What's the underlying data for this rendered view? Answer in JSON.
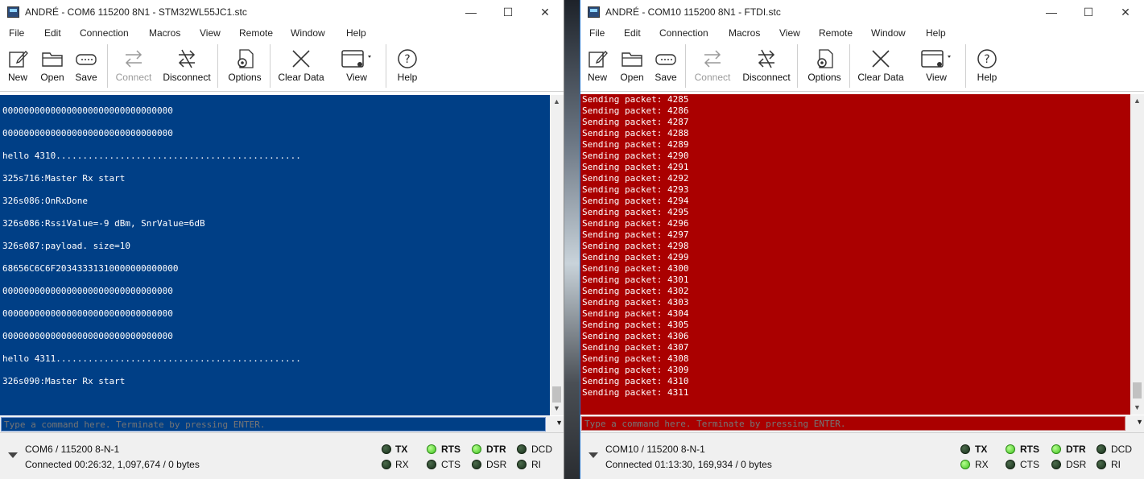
{
  "left": {
    "title": "ANDRÉ - COM6 115200 8N1 - STM32WL55JC1.stc",
    "menu": [
      "File",
      "Edit",
      "Connection",
      "Macros",
      "View",
      "Remote",
      "Window",
      "Help"
    ],
    "toolbar": {
      "new": "New",
      "open": "Open",
      "save": "Save",
      "connect": "Connect",
      "disconnect": "Disconnect",
      "options": "Options",
      "clear": "Clear Data",
      "view": "View",
      "help": "Help"
    },
    "terminal_bg": "#003f86",
    "lines": [
      "00000000000000000000000000000000",
      "",
      "00000000000000000000000000000000",
      "",
      "hello 4310..............................................",
      "",
      "325s716:Master Rx start",
      "",
      "326s086:OnRxDone",
      "",
      "326s086:RssiValue=-9 dBm, SnrValue=6dB",
      "",
      "326s087:payload. size=10",
      "",
      "68656C6C6F20343331310000000000000",
      "",
      "00000000000000000000000000000000",
      "",
      "00000000000000000000000000000000",
      "",
      "00000000000000000000000000000000",
      "",
      "hello 4311..............................................",
      "",
      "326s090:Master Rx start"
    ],
    "command_placeholder": "Type a command here. Terminate by pressing ENTER.",
    "status": {
      "port": "COM6 / 115200 8-N-1",
      "connection": "Connected 00:26:32, 1,097,674 / 0 bytes",
      "tx": "TX",
      "rx": "RX",
      "rts": "RTS",
      "cts": "CTS",
      "dtr": "DTR",
      "dsr": "DSR",
      "dcd": "DCD",
      "ri": "RI"
    }
  },
  "right": {
    "title": "ANDRÉ - COM10 115200 8N1 - FTDI.stc",
    "menu": [
      "File",
      "Edit",
      "Connection",
      "Macros",
      "View",
      "Remote",
      "Window",
      "Help"
    ],
    "toolbar": {
      "new": "New",
      "open": "Open",
      "save": "Save",
      "connect": "Connect",
      "disconnect": "Disconnect",
      "options": "Options",
      "clear": "Clear Data",
      "view": "View",
      "help": "Help"
    },
    "terminal_bg": "#aa0000",
    "lines": [
      "Sending packet: 4285",
      "Sending packet: 4286",
      "Sending packet: 4287",
      "Sending packet: 4288",
      "Sending packet: 4289",
      "Sending packet: 4290",
      "Sending packet: 4291",
      "Sending packet: 4292",
      "Sending packet: 4293",
      "Sending packet: 4294",
      "Sending packet: 4295",
      "Sending packet: 4296",
      "Sending packet: 4297",
      "Sending packet: 4298",
      "Sending packet: 4299",
      "Sending packet: 4300",
      "Sending packet: 4301",
      "Sending packet: 4302",
      "Sending packet: 4303",
      "Sending packet: 4304",
      "Sending packet: 4305",
      "Sending packet: 4306",
      "Sending packet: 4307",
      "Sending packet: 4308",
      "Sending packet: 4309",
      "Sending packet: 4310",
      "Sending packet: 4311"
    ],
    "command_placeholder": "Type a command here. Terminate by pressing ENTER.",
    "status": {
      "port": "COM10 / 115200 8-N-1",
      "connection": "Connected 01:13:30, 169,934 / 0 bytes",
      "tx": "TX",
      "rx": "RX",
      "rts": "RTS",
      "cts": "CTS",
      "dtr": "DTR",
      "dsr": "DSR",
      "dcd": "DCD",
      "ri": "RI"
    }
  },
  "title_controls": {
    "minimize": "—",
    "maximize": "☐",
    "close": "✕"
  },
  "led_states": {
    "left": {
      "tx": "off",
      "rx": "off",
      "rts": "on",
      "cts": "off",
      "dtr": "on",
      "dsr": "off",
      "dcd": "off",
      "ri": "off"
    },
    "right": {
      "tx": "off",
      "rx": "on",
      "rts": "on",
      "cts": "off",
      "dtr": "on",
      "dsr": "off",
      "dcd": "off",
      "ri": "off"
    }
  }
}
